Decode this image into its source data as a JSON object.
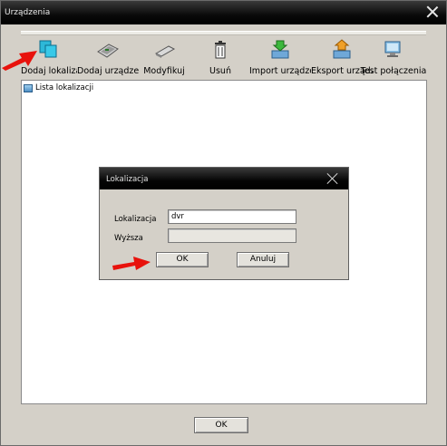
{
  "window": {
    "title": "Urządzenia"
  },
  "toolbar": {
    "items": [
      {
        "label": "Dodaj lokalizację",
        "icon": "add-location-icon"
      },
      {
        "label": "Dodaj urządzenie",
        "icon": "add-device-icon"
      },
      {
        "label": "Modyfikuj",
        "icon": "modify-icon"
      },
      {
        "label": "Usuń",
        "icon": "trash-icon"
      },
      {
        "label": "Import urządzeń",
        "icon": "import-icon"
      },
      {
        "label": "Eksport urządzeń",
        "icon": "export-icon"
      },
      {
        "label": "Test połączenia",
        "icon": "test-connection-icon"
      }
    ]
  },
  "tree": {
    "root_label": "Lista lokalizacji",
    "root_icon": "location-list-icon"
  },
  "footer": {
    "ok_label": "OK"
  },
  "dialog": {
    "title": "Lokalizacja",
    "location_label": "Lokalizacja",
    "location_value": "dvr",
    "parent_label": "Wyższa",
    "parent_value": "",
    "ok_label": "OK",
    "cancel_label": "Anuluj"
  },
  "colors": {
    "titlebar": "#000000",
    "window_bg": "#d4d0c8",
    "arrow": "#e8120c"
  }
}
